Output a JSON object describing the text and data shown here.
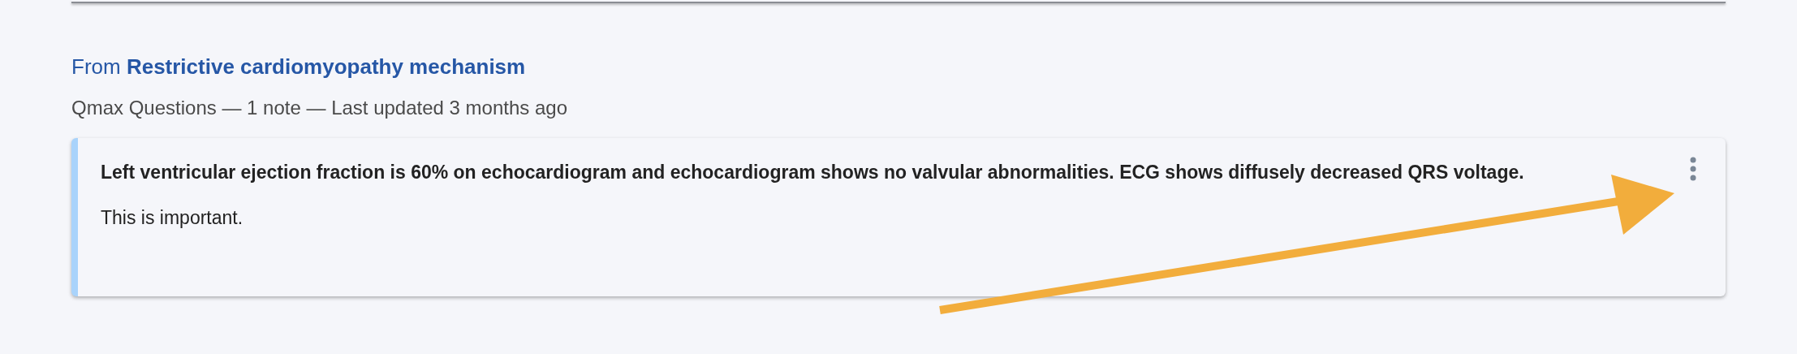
{
  "source": {
    "link": "From **Restrictive cardiomyopathy mechanism**",
    "meta": "Qmax Questions — 1 note — Last updated 3 months ago"
  },
  "note": {
    "highlight": "Left ventricular ejection fraction is 60% on echocardiogram and echocardiogram shows no valvular abnormalities. ECG shows diffusely decreased QRS voltage.",
    "comment": "This is important."
  },
  "annotation": {
    "kind": "arrow"
  }
}
